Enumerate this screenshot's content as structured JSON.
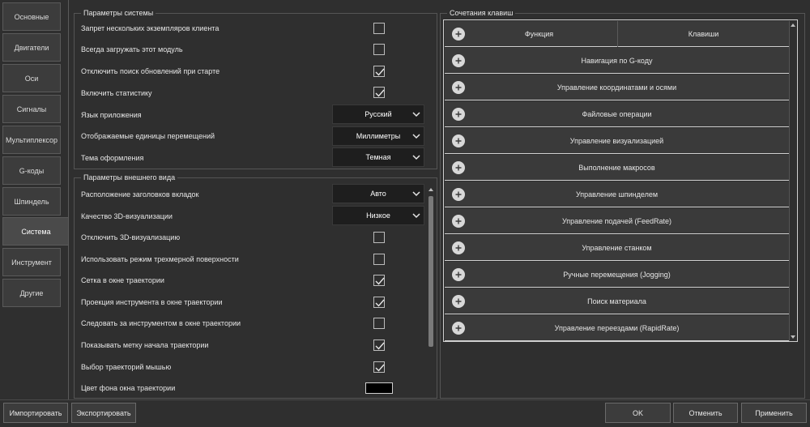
{
  "left_tabs": [
    {
      "label": "Основные",
      "active": false
    },
    {
      "label": "Двигатели",
      "active": false
    },
    {
      "label": "Оси",
      "active": false
    },
    {
      "label": "Сигналы",
      "active": false
    },
    {
      "label": "Мультиплексор",
      "active": false
    },
    {
      "label": "G-коды",
      "active": false
    },
    {
      "label": "Шпиндель",
      "active": false
    },
    {
      "label": "Система",
      "active": true
    },
    {
      "label": "Инструмент",
      "active": false
    },
    {
      "label": "Другие",
      "active": false
    }
  ],
  "system_params": {
    "title": "Параметры системы",
    "items": [
      {
        "label": "Запрет нескольких экземпляров клиента",
        "checked": false
      },
      {
        "label": "Всегда загружать этот модуль",
        "checked": false
      },
      {
        "label": "Отключить поиск обновлений при старте",
        "checked": true
      },
      {
        "label": "Включить статистику",
        "checked": true
      }
    ],
    "combos": [
      {
        "label": "Язык приложения",
        "value": "Русский"
      },
      {
        "label": "Отображаемые единицы перемещений",
        "value": "Миллиметры"
      },
      {
        "label": "Тема оформления",
        "value": "Темная"
      }
    ]
  },
  "appearance": {
    "title": "Параметры внешнего вида",
    "combos": [
      {
        "label": "Расположение заголовков вкладок",
        "value": "Авто"
      },
      {
        "label": "Качество 3D-визуализации",
        "value": "Низкое"
      }
    ],
    "items": [
      {
        "label": "Отключить 3D-визуализацию",
        "checked": false
      },
      {
        "label": "Использовать режим трехмерной поверхности",
        "checked": false
      },
      {
        "label": "Сетка в окне траектории",
        "checked": true
      },
      {
        "label": "Проекция инструмента в окне траектории",
        "checked": true
      },
      {
        "label": "Следовать за инструментом в окне траектории",
        "checked": false
      },
      {
        "label": "Показывать метку начала траектории",
        "checked": true
      },
      {
        "label": "Выбор траекторий мышью",
        "checked": true
      }
    ],
    "color_label": "Цвет фона окна траектории",
    "color_value": "#000000"
  },
  "hotkeys": {
    "title": "Сочетания клавиш",
    "col_function": "Функция",
    "col_keys": "Клавиши",
    "rows": [
      "Навигация по G-коду",
      "Управление координатами и осями",
      "Файловые операции",
      "Управление визуализацией",
      "Выполнение макросов",
      "Управление шпинделем",
      "Управление подачей (FeedRate)",
      "Управление станком",
      "Ручные перемещения (Jogging)",
      "Поиск материала",
      "Управление переездами (RapidRate)"
    ]
  },
  "buttons": {
    "import": "Импортировать",
    "export": "Экспортировать",
    "ok": "OK",
    "cancel": "Отменить",
    "apply": "Применить"
  }
}
